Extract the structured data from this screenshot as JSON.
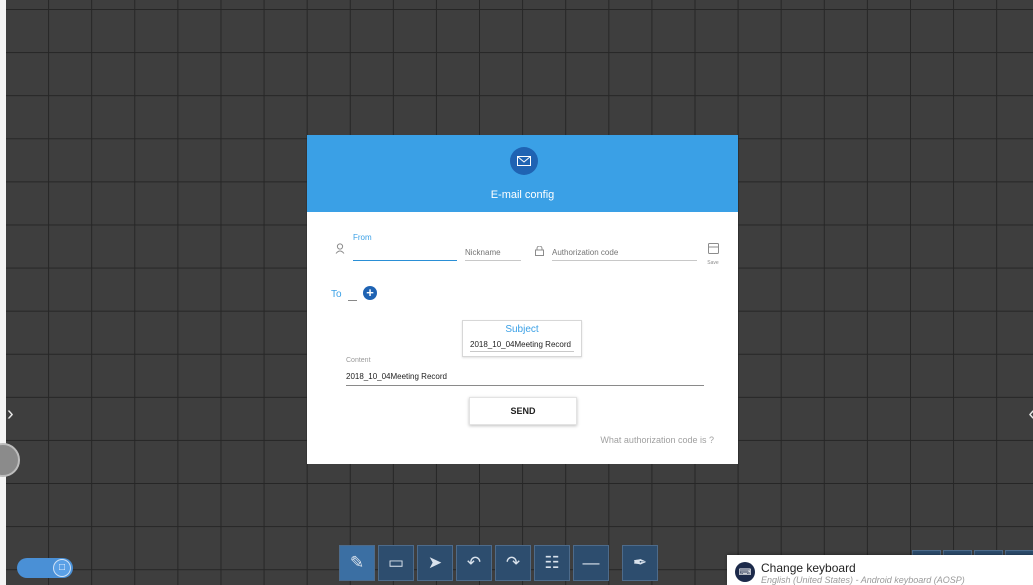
{
  "dialog": {
    "title": "E-mail config",
    "from_label": "From",
    "from_value": "",
    "nickname_placeholder": "Nickname",
    "auth_placeholder": "Authorization code",
    "save_label": "Save",
    "to_label": "To",
    "subject_label": "Subject",
    "subject_value": "2018_10_04Meeting Record",
    "content_label": "Content",
    "content_value": "2018_10_04Meeting Record",
    "send_label": "SEND",
    "help_link": "What authorization code is ?"
  },
  "notification": {
    "title": "Change keyboard",
    "subtitle": "English (United States) - Android keyboard (AOSP)"
  },
  "toolbar": {
    "tools": [
      "pen-icon",
      "eraser-icon",
      "select-arrow-icon",
      "undo-icon",
      "redo-icon",
      "grid-menu-icon",
      "minimize-icon",
      "clear-broom-icon"
    ],
    "active_tool": "pen-icon"
  },
  "colors": {
    "header_blue": "#3aa0e6",
    "accent_blue": "#1f63b3",
    "canvas_background": "#3e3e3e",
    "grid_lines": "#262626"
  }
}
